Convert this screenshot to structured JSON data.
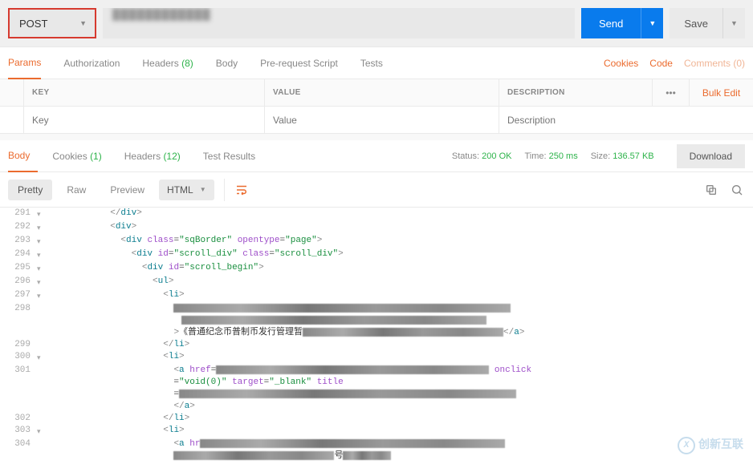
{
  "request": {
    "method": "POST",
    "url_blurred": "████████████",
    "send_label": "Send",
    "save_label": "Save"
  },
  "req_tabs": {
    "params": "Params",
    "authorization": "Authorization",
    "headers": "Headers",
    "headers_count": "(8)",
    "body": "Body",
    "prerequest": "Pre-request Script",
    "tests": "Tests"
  },
  "req_links": {
    "cookies": "Cookies",
    "code": "Code",
    "comments": "Comments (0)"
  },
  "params_headers": {
    "key": "KEY",
    "value": "VALUE",
    "description": "DESCRIPTION",
    "bulk": "Bulk Edit"
  },
  "params_placeholders": {
    "key": "Key",
    "value": "Value",
    "description": "Description"
  },
  "resp_tabs": {
    "body": "Body",
    "cookies": "Cookies",
    "cookies_count": "(1)",
    "headers": "Headers",
    "headers_count": "(12)",
    "test_results": "Test Results"
  },
  "resp_status": {
    "status_label": "Status:",
    "status_value": "200 OK",
    "time_label": "Time:",
    "time_value": "250 ms",
    "size_label": "Size:",
    "size_value": "136.57 KB",
    "download": "Download"
  },
  "resp_views": {
    "pretty": "Pretty",
    "raw": "Raw",
    "preview": "Preview",
    "format": "HTML"
  },
  "code_lines": [
    {
      "n": 291,
      "fold": "▾",
      "indent": 12,
      "html": "<span class='c-ang'>&lt;/</span><span class='c-tag'>div</span><span class='c-ang'>&gt;</span>"
    },
    {
      "n": 292,
      "fold": "▾",
      "indent": 12,
      "html": "<span class='c-ang'>&lt;</span><span class='c-tag'>div</span><span class='c-ang'>&gt;</span>"
    },
    {
      "n": 293,
      "fold": "▾",
      "indent": 14,
      "html": "<span class='c-ang'>&lt;</span><span class='c-tag'>div</span> <span class='c-attr'>class</span>=<span class='c-str'>\"sqBorder\"</span> <span class='c-attr'>opentype</span>=<span class='c-str'>\"page\"</span><span class='c-ang'>&gt;</span>"
    },
    {
      "n": 294,
      "fold": "▾",
      "indent": 16,
      "html": "<span class='c-ang'>&lt;</span><span class='c-tag'>div</span> <span class='c-attr'>id</span>=<span class='c-str'>\"scroll_div\"</span> <span class='c-attr'>class</span>=<span class='c-str'>\"scroll_div\"</span><span class='c-ang'>&gt;</span>"
    },
    {
      "n": 295,
      "fold": "▾",
      "indent": 18,
      "html": "<span class='c-ang'>&lt;</span><span class='c-tag'>div</span> <span class='c-attr'>id</span>=<span class='c-str'>\"scroll_begin\"</span><span class='c-ang'>&gt;</span>"
    },
    {
      "n": 296,
      "fold": "▾",
      "indent": 20,
      "html": "<span class='c-ang'>&lt;</span><span class='c-tag'>ul</span><span class='c-ang'>&gt;</span>"
    },
    {
      "n": 297,
      "fold": "▾",
      "indent": 22,
      "html": "<span class='c-ang'>&lt;</span><span class='c-tag'>li</span><span class='c-ang'>&gt;</span>"
    },
    {
      "n": 298,
      "fold": "",
      "indent": 24,
      "html": "<span class='pixel-block' style='width:420px'></span>"
    },
    {
      "n": "",
      "fold": "",
      "indent": 24,
      "html": "<span class='pixel-block' style='width:380px;margin-left:10px'></span>"
    },
    {
      "n": "",
      "fold": "",
      "indent": 24,
      "html": "<span class='c-ang'>&gt;</span><span class='c-txt'>《普通纪念币普制币发行管理暂</span><span class='pixel-block' style='width:250px'></span><span class='c-ang'>&lt;/</span><span class='c-tag'>a</span><span class='c-ang'>&gt;</span>"
    },
    {
      "n": 299,
      "fold": "",
      "indent": 22,
      "html": "<span class='c-ang'>&lt;/</span><span class='c-tag'>li</span><span class='c-ang'>&gt;</span>"
    },
    {
      "n": 300,
      "fold": "▾",
      "indent": 22,
      "html": "<span class='c-ang'>&lt;</span><span class='c-tag'>li</span><span class='c-ang'>&gt;</span>"
    },
    {
      "n": 301,
      "fold": "",
      "indent": 24,
      "html": "<span class='c-ang'>&lt;</span><span class='c-tag'>a</span> <span class='c-attr'>href</span>=<span class='pixel-block' style='width:340px'></span> <span class='c-attr'>onclick</span>"
    },
    {
      "n": "",
      "fold": "",
      "indent": 24,
      "html": "=<span class='c-str'>\"void(0)\"</span> <span class='c-attr'>target</span>=<span class='c-str'>\"_blank\"</span> <span class='c-attr'>title</span>"
    },
    {
      "n": "",
      "fold": "",
      "indent": 24,
      "html": "=<span class='pixel-block' style='width:420px'></span>"
    },
    {
      "n": "",
      "fold": "",
      "indent": 24,
      "html": "<span class='c-ang'>&lt;/</span><span class='c-tag'>a</span><span class='c-ang'>&gt;</span>"
    },
    {
      "n": 302,
      "fold": "",
      "indent": 22,
      "html": "<span class='c-ang'>&lt;/</span><span class='c-tag'>li</span><span class='c-ang'>&gt;</span>"
    },
    {
      "n": 303,
      "fold": "▾",
      "indent": 22,
      "html": "<span class='c-ang'>&lt;</span><span class='c-tag'>li</span><span class='c-ang'>&gt;</span>"
    },
    {
      "n": 304,
      "fold": "",
      "indent": 24,
      "html": "<span class='c-ang'>&lt;</span><span class='c-tag'>a</span> <span class='c-attr'>hr</span><span class='pixel-block' style='width:380px'></span>"
    },
    {
      "n": "",
      "fold": "",
      "indent": 24,
      "html": "<span class='pixel-block' style='width:200px'></span><span class='c-txt'>号</span><span class='pixel-block' style='width:60px'></span>"
    }
  ],
  "watermark": "创新互联"
}
